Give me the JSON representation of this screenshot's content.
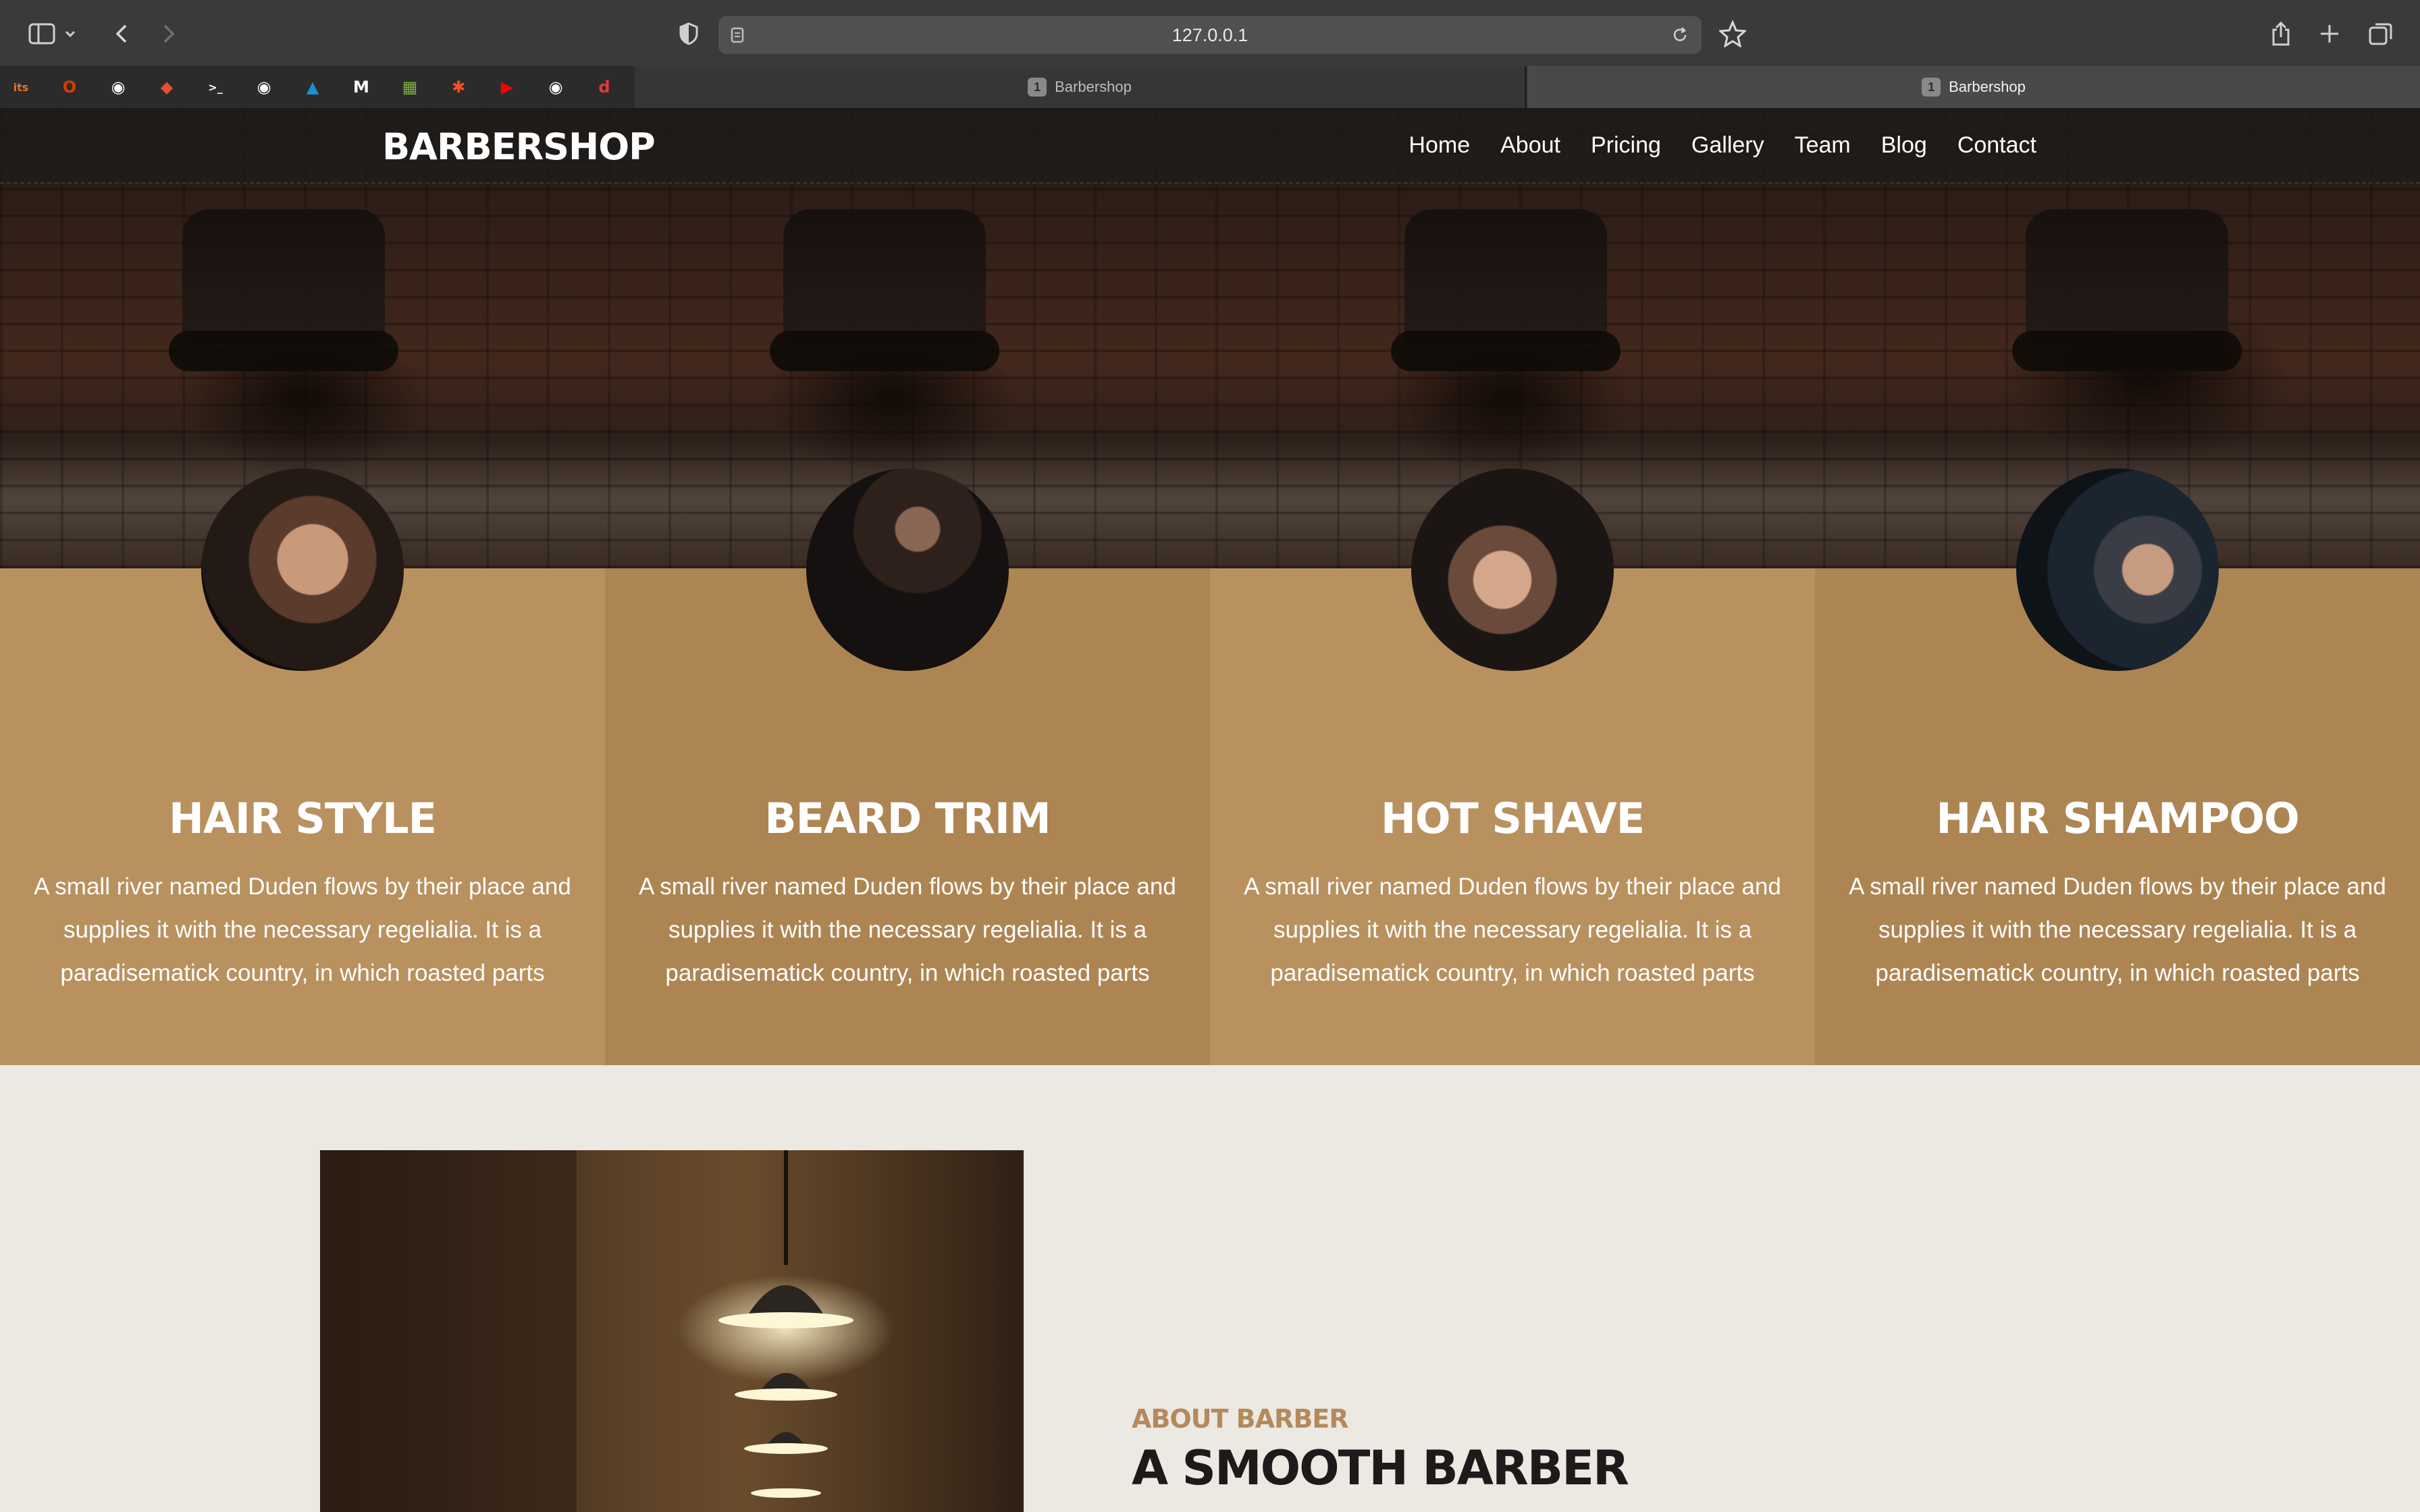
{
  "browser": {
    "url": "127.0.0.1",
    "tabs": [
      {
        "number": "1",
        "title": "Barbershop",
        "active": false
      },
      {
        "number": "1",
        "title": "Barbershop",
        "active": true
      }
    ],
    "favorites": [
      {
        "icon": "its-icon",
        "glyph": "its",
        "color": "#e0742f"
      },
      {
        "icon": "office-icon",
        "glyph": "O",
        "color": "#d83b01"
      },
      {
        "icon": "github-icon",
        "glyph": "◉",
        "color": "#ffffff"
      },
      {
        "icon": "git-icon",
        "glyph": "◆",
        "color": "#e84e31"
      },
      {
        "icon": "terminal-icon",
        "glyph": ">_",
        "color": "#ffffff"
      },
      {
        "icon": "github-icon",
        "glyph": "◉",
        "color": "#ffffff"
      },
      {
        "icon": "arch-icon",
        "glyph": "▲",
        "color": "#1793d1"
      },
      {
        "icon": "m-icon",
        "glyph": "M",
        "color": "#ffffff"
      },
      {
        "icon": "image-icon",
        "glyph": "▦",
        "color": "#7cb342"
      },
      {
        "icon": "asterisk-icon",
        "glyph": "✱",
        "color": "#f4511e"
      },
      {
        "icon": "youtube-icon",
        "glyph": "▶",
        "color": "#ff0000"
      },
      {
        "icon": "github-icon",
        "glyph": "◉",
        "color": "#ffffff"
      },
      {
        "icon": "d-icon",
        "glyph": "d",
        "color": "#e53935"
      }
    ]
  },
  "nav": {
    "brand": "BARBERSHOP",
    "links": [
      "Home",
      "About",
      "Pricing",
      "Gallery",
      "Team",
      "Blog",
      "Contact"
    ]
  },
  "services": [
    {
      "title": "HAIR STYLE",
      "description": "A small river named Duden flows by their place and supplies it with the necessary regelialia. It is a paradisematick country, in which roasted parts",
      "bg": "#b8915f",
      "avatar": "hair-style-photo-icon"
    },
    {
      "title": "BEARD TRIM",
      "description": "A small river named Duden flows by their place and supplies it with the necessary regelialia. It is a paradisematick country, in which roasted parts",
      "bg": "#ad8553",
      "avatar": "beard-trim-photo-icon"
    },
    {
      "title": "HOT SHAVE",
      "description": "A small river named Duden flows by their place and supplies it with the necessary regelialia. It is a paradisematick country, in which roasted parts",
      "bg": "#b8915f",
      "avatar": "hot-shave-photo-icon"
    },
    {
      "title": "HAIR SHAMPOO",
      "description": "A small river named Duden flows by their place and supplies it with the necessary regelialia. It is a paradisematick country, in which roasted parts",
      "bg": "#ad8553",
      "avatar": "hair-shampoo-photo-icon"
    }
  ],
  "about": {
    "kicker": "ABOUT BARBER",
    "title": "A SMOOTH BARBER"
  },
  "colors": {
    "accent": "#b48a5c",
    "page_bg": "#ece8e2",
    "heading": "#1d1b1a"
  }
}
